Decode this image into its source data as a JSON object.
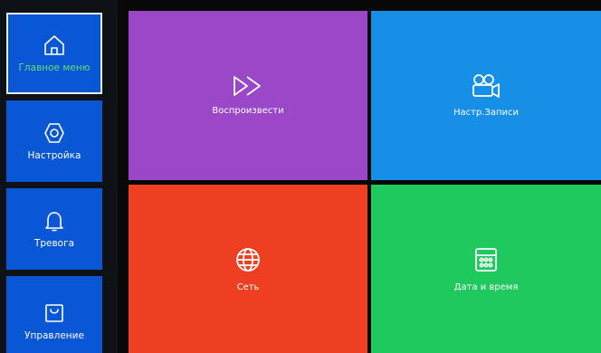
{
  "sidebar": {
    "items": [
      {
        "label": "Главное меню",
        "icon": "home-icon",
        "active": true
      },
      {
        "label": "Настройка",
        "icon": "settings-icon",
        "active": false
      },
      {
        "label": "Тревога",
        "icon": "bell-icon",
        "active": false
      },
      {
        "label": "Управление",
        "icon": "bag-icon",
        "active": false
      }
    ]
  },
  "tiles": [
    {
      "label": "Воспроизвести",
      "icon": "fast-forward-icon",
      "color": "#9a48c8"
    },
    {
      "label": "Настр.Записи",
      "icon": "video-camera-icon",
      "color": "#168fe6"
    },
    {
      "label": "Сеть",
      "icon": "globe-icon",
      "color": "#ee3f22"
    },
    {
      "label": "Дата и время",
      "icon": "calendar-icon",
      "color": "#1ec95e"
    }
  ],
  "colors": {
    "sidebar_blue": "#0a57d6",
    "active_label": "#63e06d",
    "background": "#080808"
  }
}
